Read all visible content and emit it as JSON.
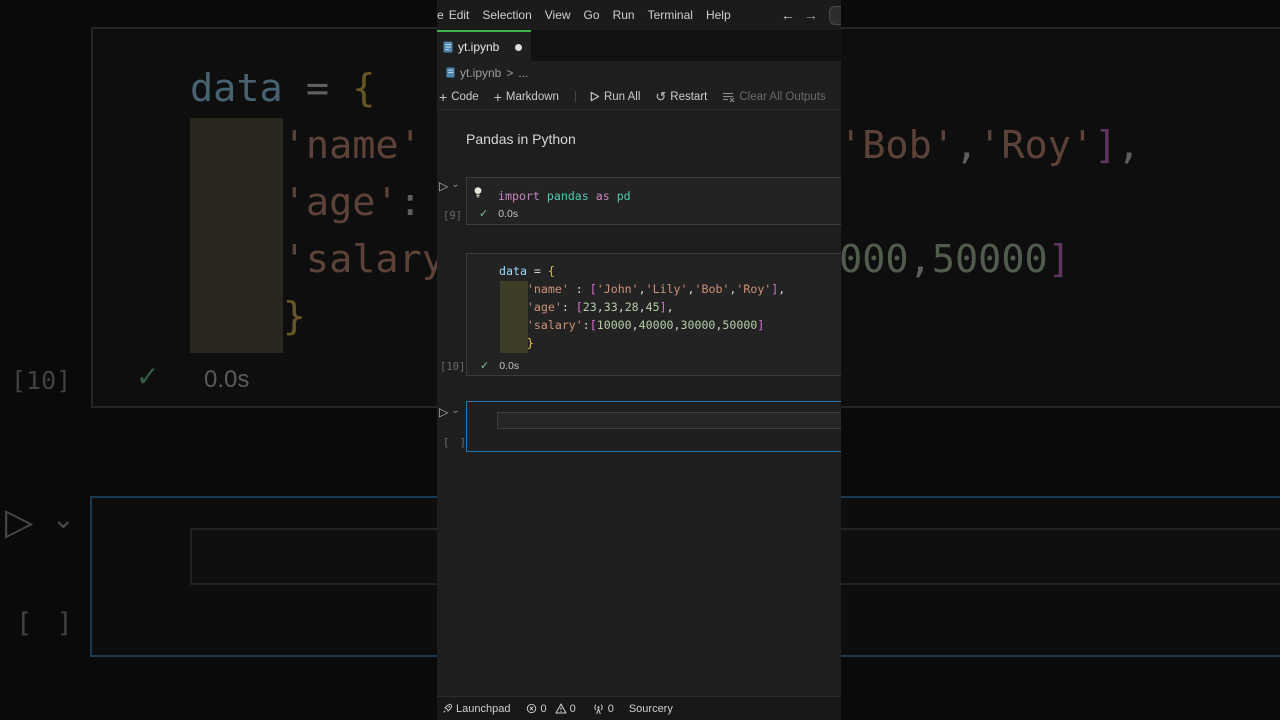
{
  "colors": {
    "keyword": "#C586C0",
    "module": "#4EC9B0",
    "variable": "#9CDCFE",
    "string": "#CE9178",
    "number": "#B5CEA8",
    "brace": "#E3C04D",
    "bracket": "#D670D6",
    "punct": "#D4D4D4",
    "check_green": "#73C991",
    "tab_indicator_green": "#3FB24F",
    "cell_focus_blue": "#2077B4"
  },
  "icons": {
    "run": "▷",
    "chevron_down": "⌄",
    "back_arrow": "←",
    "forward_arrow": "→",
    "check": "✓",
    "plus": "+",
    "restart": "↺",
    "modified_dot": "",
    "breadcrumb_separator": ">",
    "breadcrumb_ellipsis": "...",
    "toolbar_separator": "|"
  },
  "menu_bar": {
    "clipped_first_item": "e",
    "items": [
      "Edit",
      "Selection",
      "View",
      "Go",
      "Run",
      "Terminal",
      "Help"
    ]
  },
  "tab_bar": {
    "active_tab": "yt.ipynb"
  },
  "breadcrumb": {
    "file": "yt.ipynb"
  },
  "toolbar": {
    "code": "Code",
    "markdown": "Markdown",
    "run_all": "Run All",
    "restart": "Restart",
    "clear_all_outputs": "Clear All Outputs"
  },
  "notebook": {
    "markdown_heading": "Pandas in Python",
    "cells": [
      {
        "exec_label": "[9]",
        "duration": "0.0s",
        "lines": [
          [
            {
              "t": "import",
              "c": "keyword"
            },
            {
              "t": " ",
              "c": "punct"
            },
            {
              "t": "pandas",
              "c": "module"
            },
            {
              "t": " ",
              "c": "punct"
            },
            {
              "t": "as",
              "c": "keyword"
            },
            {
              "t": " ",
              "c": "punct"
            },
            {
              "t": "pd",
              "c": "module"
            }
          ]
        ]
      },
      {
        "exec_label": "[10]",
        "duration": "0.0s",
        "lines": [
          [
            {
              "t": "data",
              "c": "variable"
            },
            {
              "t": " = ",
              "c": "punct"
            },
            {
              "t": "{",
              "c": "brace"
            }
          ],
          [
            {
              "t": "    ",
              "c": "punct"
            },
            {
              "t": "'name'",
              "c": "string"
            },
            {
              "t": " : ",
              "c": "punct"
            },
            {
              "t": "[",
              "c": "bracket"
            },
            {
              "t": "'John'",
              "c": "string"
            },
            {
              "t": ",",
              "c": "punct"
            },
            {
              "t": "'Lily'",
              "c": "string"
            },
            {
              "t": ",",
              "c": "punct"
            },
            {
              "t": "'Bob'",
              "c": "string"
            },
            {
              "t": ",",
              "c": "punct"
            },
            {
              "t": "'Roy'",
              "c": "string"
            },
            {
              "t": "]",
              "c": "bracket"
            },
            {
              "t": ",",
              "c": "punct"
            }
          ],
          [
            {
              "t": "    ",
              "c": "punct"
            },
            {
              "t": "'age'",
              "c": "string"
            },
            {
              "t": ": ",
              "c": "punct"
            },
            {
              "t": "[",
              "c": "bracket"
            },
            {
              "t": "23",
              "c": "number"
            },
            {
              "t": ",",
              "c": "punct"
            },
            {
              "t": "33",
              "c": "number"
            },
            {
              "t": ",",
              "c": "punct"
            },
            {
              "t": "28",
              "c": "number"
            },
            {
              "t": ",",
              "c": "punct"
            },
            {
              "t": "45",
              "c": "number"
            },
            {
              "t": "]",
              "c": "bracket"
            },
            {
              "t": ",",
              "c": "punct"
            }
          ],
          [
            {
              "t": "    ",
              "c": "punct"
            },
            {
              "t": "'salary'",
              "c": "string"
            },
            {
              "t": ":",
              "c": "punct"
            },
            {
              "t": "[",
              "c": "bracket"
            },
            {
              "t": "10000",
              "c": "number"
            },
            {
              "t": ",",
              "c": "punct"
            },
            {
              "t": "40000",
              "c": "number"
            },
            {
              "t": ",",
              "c": "punct"
            },
            {
              "t": "30000",
              "c": "number"
            },
            {
              "t": ",",
              "c": "punct"
            },
            {
              "t": "50000",
              "c": "number"
            },
            {
              "t": "]",
              "c": "bracket"
            }
          ],
          [
            {
              "t": "    ",
              "c": "punct"
            },
            {
              "t": "}",
              "c": "brace"
            }
          ]
        ]
      },
      {
        "exec_label": "[ ]",
        "lines": []
      }
    ]
  },
  "status_bar": {
    "launchpad": "Launchpad",
    "errors": "0",
    "warnings": "0",
    "ports": "0",
    "sourcery": "Sourcery"
  }
}
